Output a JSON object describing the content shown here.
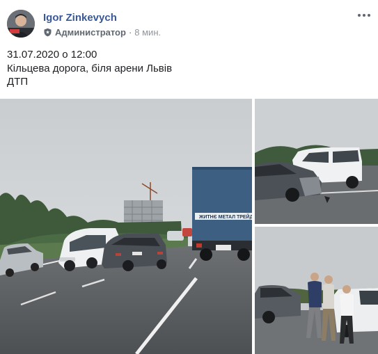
{
  "post": {
    "author": "Igor Zinkevych",
    "role": "Администратор",
    "separator": "·",
    "time": "8 мин.",
    "text_lines": [
      "31.07.2020 о 12:00",
      "Кільцева дорога, біля арени Львів",
      "ДТП"
    ],
    "truck_sign": "ЖИТНЄ МЕТАЛ ТРЕЙДИНГ",
    "icons": {
      "role_badge": "shield-icon",
      "more": "more-options-icon"
    }
  }
}
